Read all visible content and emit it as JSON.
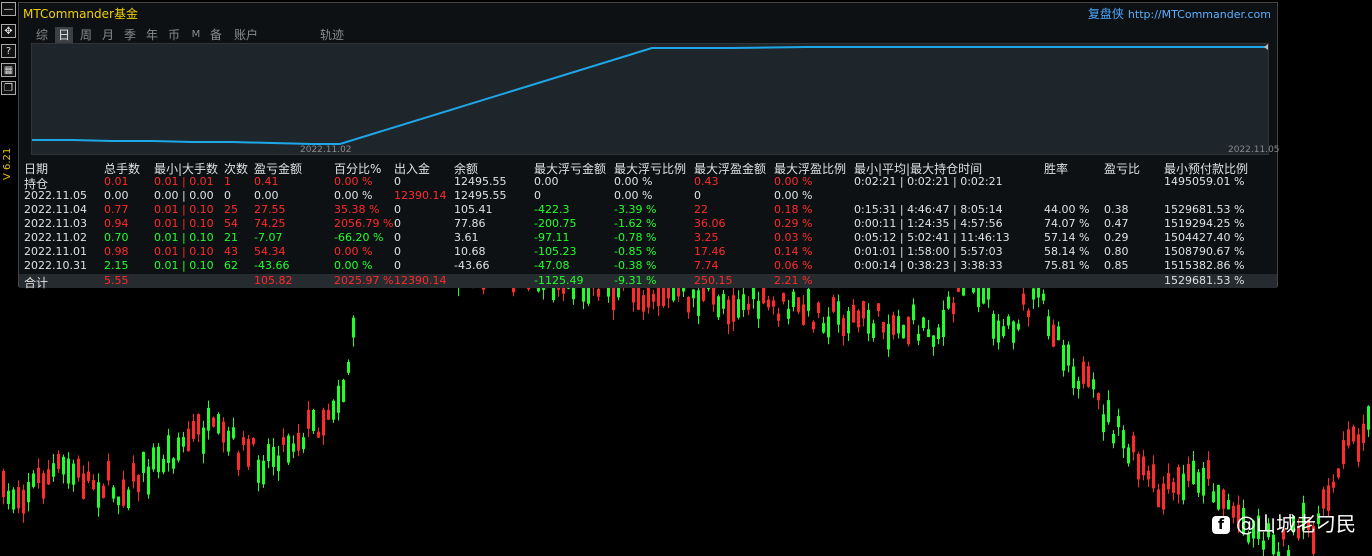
{
  "app": {
    "title": "MTCommander基金",
    "brand_name": "复盘侠",
    "brand_url": "http://MTCommander.com",
    "version": "V 6.21"
  },
  "left_toolbar": {
    "items": [
      {
        "icon": "minimize-icon",
        "glyph": "—"
      },
      {
        "icon": "move-icon",
        "glyph": "✥"
      },
      {
        "icon": "help-icon",
        "glyph": "?"
      },
      {
        "icon": "grid-icon",
        "glyph": "▦"
      },
      {
        "icon": "window-icon",
        "glyph": "❐"
      }
    ]
  },
  "tabs": [
    {
      "label": "综",
      "active": false
    },
    {
      "label": "日",
      "active": true
    },
    {
      "label": "周",
      "active": false
    },
    {
      "label": "月",
      "active": false
    },
    {
      "label": "季",
      "active": false
    },
    {
      "label": "年",
      "active": false
    },
    {
      "label": "币",
      "active": false
    },
    {
      "label": "M",
      "active": false
    },
    {
      "label": "备",
      "active": false
    },
    {
      "label": "账户",
      "active": false
    },
    {
      "label": "轨迹",
      "active": false
    }
  ],
  "equity_chart": {
    "start_date": "2022.11.02",
    "end_date": "2022.11.05",
    "line_color": "#1ea7e8"
  },
  "stats": {
    "headers": [
      "日期",
      "总手数",
      "最小|大手数",
      "次数",
      "盈亏金额",
      "百分比%",
      "出入金",
      "余额",
      "最大浮亏金额",
      "最大浮亏比例",
      "最大浮盈金额",
      "最大浮盈比例",
      "最小|平均|最大持仓时间",
      "胜率",
      "盈亏比",
      "最小预付款比例"
    ],
    "rows": [
      {
        "date": "持仓",
        "lots": "0.01",
        "minmax": "0.01 | 0.01",
        "count": "1",
        "pnl": "0.41",
        "pct": "0.00 %",
        "flow": "0",
        "balance": "12495.55",
        "maxloss": "0.00",
        "maxloss_pct": "0.00 %",
        "maxprofit": "0.43",
        "maxprofit_pct": "0.00 %",
        "hold": "0:02:21 | 0:02:21 | 0:02:21",
        "winrate": "",
        "ratio": "",
        "margin": "1495059.01 %"
      },
      {
        "date": "2022.11.05",
        "lots": "0.00",
        "minmax": "0.00 | 0.00",
        "count": "0",
        "pnl": "0.00",
        "pct": "0.00 %",
        "flow": "12390.14",
        "balance": "12495.55",
        "maxloss": "0",
        "maxloss_pct": "0.00 %",
        "maxprofit": "0",
        "maxprofit_pct": "0.00 %",
        "hold": "",
        "winrate": "",
        "ratio": "",
        "margin": ""
      },
      {
        "date": "2022.11.04",
        "lots": "0.77",
        "minmax": "0.01 | 0.10",
        "count": "25",
        "pnl": "27.55",
        "pct": "35.38 %",
        "flow": "0",
        "balance": "105.41",
        "maxloss": "-422.3",
        "maxloss_pct": "-3.39 %",
        "maxprofit": "22",
        "maxprofit_pct": "0.18 %",
        "hold": "0:15:31 | 4:46:47 | 8:05:14",
        "winrate": "44.00 %",
        "ratio": "0.38",
        "margin": "1529681.53 %"
      },
      {
        "date": "2022.11.03",
        "lots": "0.94",
        "minmax": "0.01 | 0.10",
        "count": "54",
        "pnl": "74.25",
        "pct": "2056.79 %",
        "flow": "0",
        "balance": "77.86",
        "maxloss": "-200.75",
        "maxloss_pct": "-1.62 %",
        "maxprofit": "36.06",
        "maxprofit_pct": "0.29 %",
        "hold": "0:00:11 | 1:24:35 | 4:57:56",
        "winrate": "74.07 %",
        "ratio": "0.47",
        "margin": "1519294.25 %"
      },
      {
        "date": "2022.11.02",
        "lots": "0.70",
        "minmax": "0.01 | 0.10",
        "count": "21",
        "pnl": "-7.07",
        "pct": "-66.20 %",
        "flow": "0",
        "balance": "3.61",
        "maxloss": "-97.11",
        "maxloss_pct": "-0.78 %",
        "maxprofit": "3.25",
        "maxprofit_pct": "0.03 %",
        "hold": "0:05:12 | 5:02:41 | 11:46:13",
        "winrate": "57.14 %",
        "ratio": "0.29",
        "margin": "1504427.40 %"
      },
      {
        "date": "2022.11.01",
        "lots": "0.98",
        "minmax": "0.01 | 0.10",
        "count": "43",
        "pnl": "54.34",
        "pct": "0.00 %",
        "flow": "0",
        "balance": "10.68",
        "maxloss": "-105.23",
        "maxloss_pct": "-0.85 %",
        "maxprofit": "17.46",
        "maxprofit_pct": "0.14 %",
        "hold": "0:01:01 | 1:58:00 | 5:57:03",
        "winrate": "58.14 %",
        "ratio": "0.80",
        "margin": "1508790.67 %"
      },
      {
        "date": "2022.10.31",
        "lots": "2.15",
        "minmax": "0.01 | 0.10",
        "count": "62",
        "pnl": "-43.66",
        "pct": "0.00 %",
        "flow": "0",
        "balance": "-43.66",
        "maxloss": "-47.08",
        "maxloss_pct": "-0.38 %",
        "maxprofit": "7.74",
        "maxprofit_pct": "0.06 %",
        "hold": "0:00:14 | 0:38:23 | 3:38:33",
        "winrate": "75.81 %",
        "ratio": "0.85",
        "margin": "1515382.86 %"
      }
    ],
    "total": {
      "label": "合计",
      "lots": "5.55",
      "pnl": "105.82",
      "pct": "2025.97 %",
      "flow": "12390.14",
      "maxloss": "-1125.49",
      "maxloss_pct": "-9.31 %",
      "maxprofit": "250.15",
      "maxprofit_pct": "2.21 %",
      "margin": "1529681.53 %"
    }
  },
  "watermark": {
    "text": "@山城老刁民",
    "icon": "facebook-icon"
  },
  "colors": {
    "up": "#21ff2a",
    "down": "#ff2a2a",
    "panel_bg": "#0d1114",
    "chart_bg": "#1e252b",
    "title": "#f2d000",
    "brand": "#4aa8ff"
  }
}
